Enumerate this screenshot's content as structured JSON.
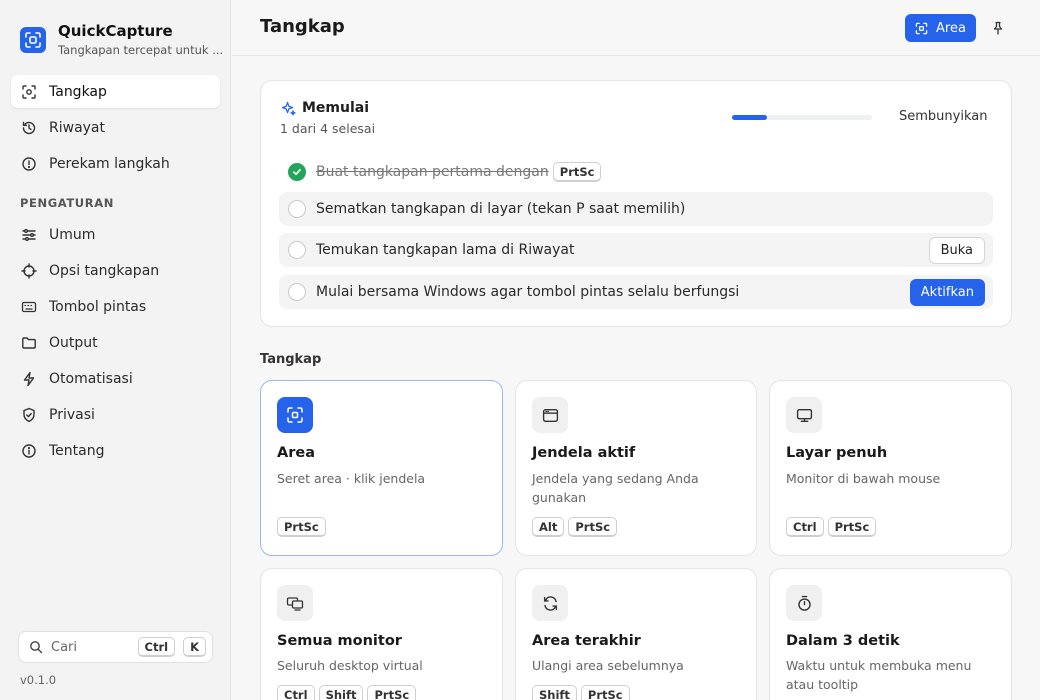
{
  "app": {
    "name": "QuickCapture",
    "tagline": "Tangkapan tercepat untuk ...",
    "version": "v0.1.0"
  },
  "colors": {
    "accent": "#2563eb",
    "success": "#22a45a"
  },
  "sidebar": {
    "items": [
      {
        "label": "Tangkap",
        "icon": "capture-icon",
        "active": true
      },
      {
        "label": "Riwayat",
        "icon": "history-icon"
      },
      {
        "label": "Perekam langkah",
        "icon": "info-circle-icon"
      }
    ],
    "settings_heading": "PENGATURAN",
    "settings_items": [
      {
        "label": "Umum",
        "icon": "sliders-icon"
      },
      {
        "label": "Opsi tangkapan",
        "icon": "crosshair-icon"
      },
      {
        "label": "Tombol pintas",
        "icon": "keyboard-icon"
      },
      {
        "label": "Output",
        "icon": "folder-icon"
      },
      {
        "label": "Otomatisasi",
        "icon": "bolt-icon"
      },
      {
        "label": "Privasi",
        "icon": "shield-icon"
      },
      {
        "label": "Tentang",
        "icon": "info-icon"
      }
    ],
    "search": {
      "placeholder": "Cari",
      "keys": [
        "Ctrl",
        "K"
      ]
    }
  },
  "header": {
    "title": "Tangkap",
    "area_button": "Area"
  },
  "onboarding": {
    "title": "Memulai",
    "progress_text": "1 dari 4 selesai",
    "progress": 0.25,
    "hide_label": "Sembunyikan",
    "tasks": [
      {
        "text": "Buat tangkapan pertama dengan",
        "key": "PrtSc",
        "done": true
      },
      {
        "text": "Sematkan tangkapan di layar (tekan P saat memilih)",
        "done": false
      },
      {
        "text": "Temukan tangkapan lama di Riwayat",
        "done": false,
        "action": "Buka"
      },
      {
        "text": "Mulai bersama Windows agar tombol pintas selalu berfungsi",
        "done": false,
        "action": "Aktifkan"
      }
    ]
  },
  "capture": {
    "heading": "Tangkap",
    "tiles": [
      {
        "title": "Area",
        "desc": "Seret area · klik jendela",
        "keys": [
          "PrtSc"
        ],
        "icon": "area-capture-icon"
      },
      {
        "title": "Jendela aktif",
        "desc": "Jendela yang sedang Anda gunakan",
        "keys": [
          "Alt",
          "PrtSc"
        ],
        "icon": "window-icon"
      },
      {
        "title": "Layar penuh",
        "desc": "Monitor di bawah mouse",
        "keys": [
          "Ctrl",
          "PrtSc"
        ],
        "icon": "monitor-icon"
      },
      {
        "title": "Semua monitor",
        "desc": "Seluruh desktop virtual",
        "keys": [
          "Ctrl",
          "Shift",
          "PrtSc"
        ],
        "icon": "multi-monitor-icon"
      },
      {
        "title": "Area terakhir",
        "desc": "Ulangi area sebelumnya",
        "keys": [
          "Shift",
          "PrtSc"
        ],
        "icon": "refresh-icon"
      },
      {
        "title": "Dalam 3 detik",
        "desc": "Waktu untuk membuka menu atau tooltip",
        "keys": [],
        "icon": "timer-icon"
      }
    ]
  }
}
